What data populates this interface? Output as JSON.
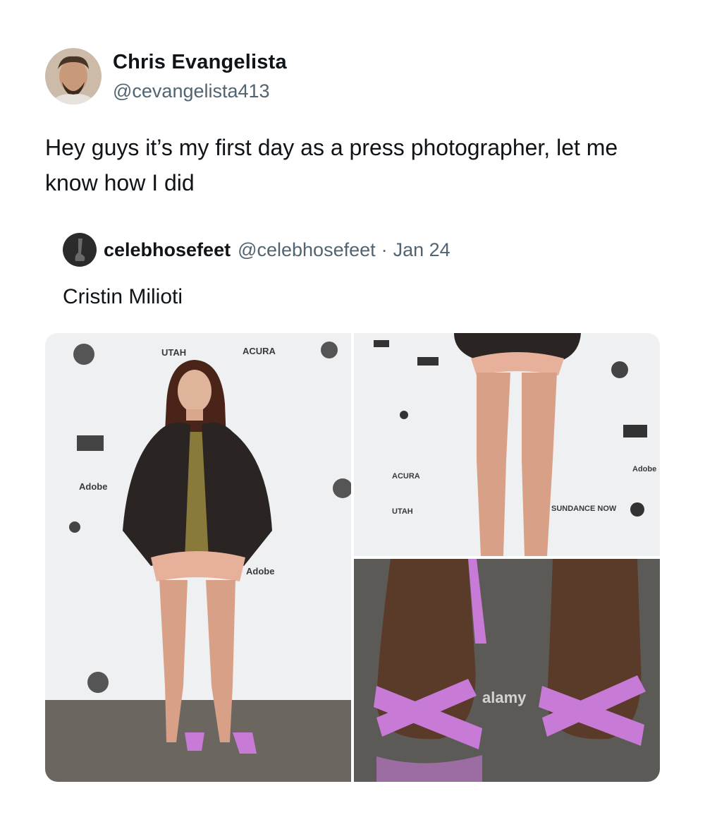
{
  "author": {
    "display_name": "Chris Evangelista",
    "handle": "@cevangelista413"
  },
  "tweet": {
    "text": "Hey guys it’s my first day as a press photographer, let me know how I did"
  },
  "quoted": {
    "display_name": "celebhosefeet",
    "handle": "@celebhosefeet",
    "separator": "·",
    "date": "Jan 24",
    "text": "Cristin Milioti"
  },
  "media": {
    "images": [
      {
        "name": "full-body-photo"
      },
      {
        "name": "legs-photo"
      },
      {
        "name": "feet-photo"
      }
    ],
    "watermark": "alamy",
    "backdrop_logos": [
      "UTAH",
      "ACURA",
      "Adobe",
      "SUNDANCE NOW"
    ]
  },
  "colors": {
    "text_primary": "#0f1419",
    "text_secondary": "#536471",
    "sandal_pink": "#c77ad6",
    "jacket": "#2a2522"
  }
}
